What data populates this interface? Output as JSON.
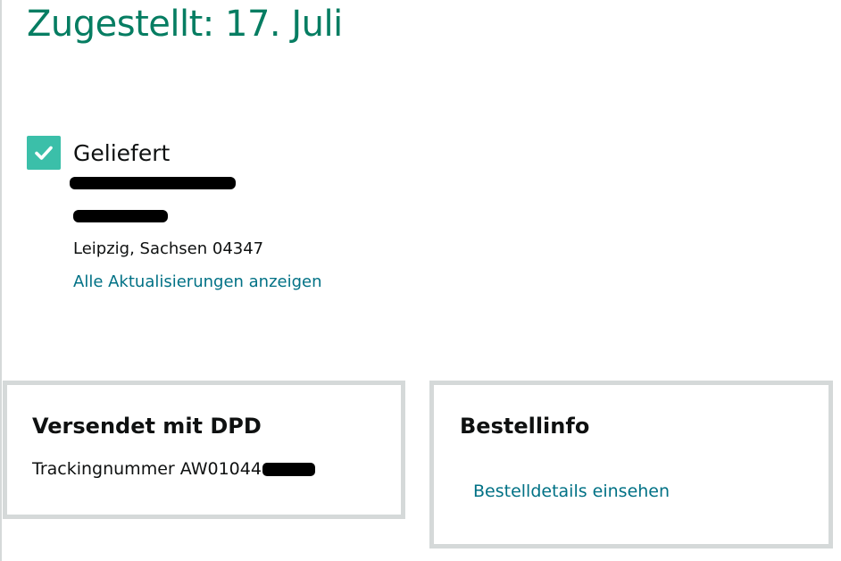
{
  "delivery": {
    "heading": "Zugestellt: 17. Juli",
    "status": "Geliefert",
    "status_icon": "check-icon",
    "address_city": "Leipzig, Sachsen 04347",
    "updates_link": "Alle Aktualisierungen anzeigen"
  },
  "shipment_card": {
    "title": "Versendet mit DPD",
    "tracking_label": "Trackingnummer AW01044"
  },
  "order_card": {
    "title": "Bestellinfo",
    "details_link": "Bestelldetails einsehen"
  },
  "colors": {
    "heading": "#067d62",
    "check_box": "#3bbfa9",
    "link": "#007185",
    "card_border": "#d5d9d9"
  }
}
